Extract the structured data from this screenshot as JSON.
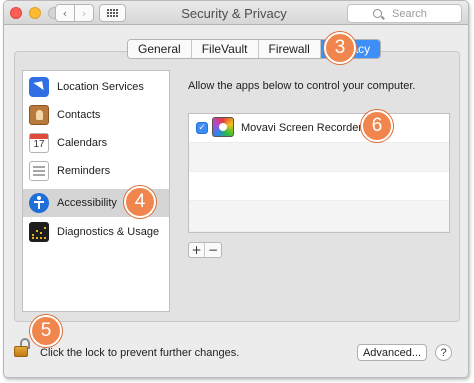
{
  "window": {
    "title": "Security & Privacy",
    "nav_back": "‹",
    "nav_forward": "›"
  },
  "search": {
    "placeholder": "Search"
  },
  "tabs": [
    {
      "label": "General",
      "active": false
    },
    {
      "label": "FileVault",
      "active": false
    },
    {
      "label": "Firewall",
      "active": false
    },
    {
      "label": "Privacy",
      "active": true
    }
  ],
  "sidebar": {
    "items": [
      {
        "label": "Location Services",
        "icon": "location-icon",
        "selected": false
      },
      {
        "label": "Contacts",
        "icon": "contacts-icon",
        "selected": false
      },
      {
        "label": "Calendars",
        "icon": "calendar-icon",
        "selected": false,
        "icon_text": "17"
      },
      {
        "label": "Reminders",
        "icon": "reminders-icon",
        "selected": false
      },
      {
        "label": "Accessibility",
        "icon": "accessibility-icon",
        "selected": true
      },
      {
        "label": "Diagnostics & Usage",
        "icon": "diagnostics-icon",
        "selected": false
      }
    ]
  },
  "main": {
    "message": "Allow the apps below to control your computer.",
    "apps": [
      {
        "name": "Movavi Screen Recorder 10",
        "checked": true,
        "icon": "movavi-icon"
      }
    ],
    "add_label": "+",
    "remove_label": "−"
  },
  "footer": {
    "lock_text": "Click the lock to prevent further changes.",
    "advanced_label": "Advanced...",
    "help_label": "?"
  },
  "annotations": {
    "badge_privacy": "3",
    "badge_accessibility": "4",
    "badge_lock": "5",
    "badge_app": "6",
    "badge_color": "#f0864e"
  },
  "colors": {
    "accent": "#3d8ef6",
    "window_bg": "#ececec"
  }
}
